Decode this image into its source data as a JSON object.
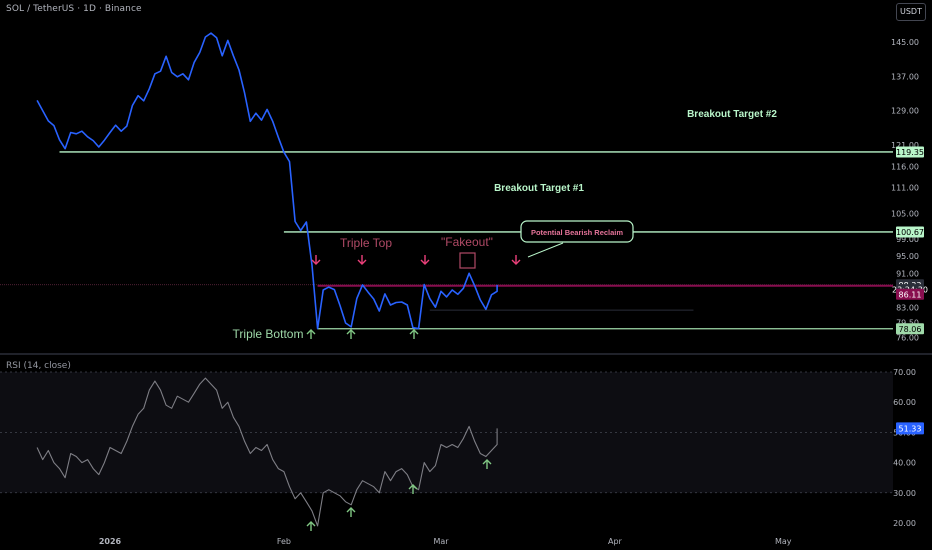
{
  "header": {
    "symbol": "SOL / TetherUS · 1D · Binance",
    "currency": "USDT"
  },
  "rsi_header": "RSI (14, close)",
  "price_axis": {
    "ticks": [
      "145.00",
      "137.00",
      "129.00",
      "121.00",
      "116.00",
      "111.00",
      "105.00",
      "99.00",
      "95.00",
      "91.00",
      "87.00",
      "83.00",
      "79.50",
      "76.00"
    ]
  },
  "price_badges": [
    {
      "label": "119.35",
      "value": 119.35,
      "color": "#b9f6ca",
      "text_color": "#000000"
    },
    {
      "label": "100.67",
      "value": 100.67,
      "color": "#b9f6ca",
      "text_color": "#000000"
    },
    {
      "label": "88.33",
      "value": 88.33,
      "color": "#2a2e39",
      "text_color": "#ffffff"
    },
    {
      "label": "23:24:30",
      "value": 87.2,
      "color": "#2a2e39",
      "text_color": "#ffffff"
    },
    {
      "label": "86.11",
      "value": 86.11,
      "color": "#880e4f",
      "text_color": "#ffffff"
    },
    {
      "label": "78.06",
      "value": 78.06,
      "color": "#9fd9a9",
      "text_color": "#000000"
    }
  ],
  "rsi_axis": {
    "ticks": [
      "70.00",
      "60.00",
      "50.00",
      "40.00",
      "30.00",
      "20.00"
    ],
    "badge": "51.33",
    "badge_value": 51.33
  },
  "time_axis": {
    "labels": [
      "2026",
      "Feb",
      "Mar",
      "Apr",
      "May"
    ]
  },
  "annotations": {
    "breakout2": "Breakout Target #2",
    "breakout1": "Breakout Target #1",
    "triple_top": "Triple Top",
    "fakeout": "\"Fakeout\"",
    "reclaim": "Potential Bearish Reclaim",
    "triple_bottom": "Triple Bottom"
  },
  "colors": {
    "price_line": "#2962ff",
    "rsi_line": "#7e7e85",
    "green_level": "#b9f6ca",
    "bottom_level": "#9fd9a9",
    "resistance": "#880e4f",
    "up_arrow": "#81c784",
    "down_arrow": "#ec407a",
    "label_red": "#b04a66"
  },
  "chart_data": [
    {
      "type": "line",
      "title": "SOL / TetherUS · 1D · Binance",
      "x": [
        "2025-12-19",
        "2025-12-20",
        "2025-12-21",
        "2025-12-22",
        "2025-12-23",
        "2025-12-24",
        "2025-12-25",
        "2025-12-26",
        "2025-12-27",
        "2025-12-28",
        "2025-12-29",
        "2025-12-30",
        "2025-12-31",
        "2026-01-01",
        "2026-01-02",
        "2026-01-03",
        "2026-01-04",
        "2026-01-05",
        "2026-01-06",
        "2026-01-07",
        "2026-01-08",
        "2026-01-09",
        "2026-01-10",
        "2026-01-11",
        "2026-01-12",
        "2026-01-13",
        "2026-01-14",
        "2026-01-15",
        "2026-01-16",
        "2026-01-17",
        "2026-01-18",
        "2026-01-19",
        "2026-01-20",
        "2026-01-21",
        "2026-01-22",
        "2026-01-23",
        "2026-01-24",
        "2026-01-25",
        "2026-01-26",
        "2026-01-27",
        "2026-01-28",
        "2026-01-29",
        "2026-01-30",
        "2026-01-31",
        "2026-02-01",
        "2026-02-02",
        "2026-02-03",
        "2026-02-04",
        "2026-02-05",
        "2026-02-06",
        "2026-02-07",
        "2026-02-08",
        "2026-02-09",
        "2026-02-10",
        "2026-02-11",
        "2026-02-12",
        "2026-02-13",
        "2026-02-14",
        "2026-02-15",
        "2026-02-16",
        "2026-02-17",
        "2026-02-18",
        "2026-02-19",
        "2026-02-20",
        "2026-02-21",
        "2026-02-22",
        "2026-02-23",
        "2026-02-24",
        "2026-02-25",
        "2026-02-26",
        "2026-02-27",
        "2026-02-28",
        "2026-03-01",
        "2026-03-02",
        "2026-03-03",
        "2026-03-04",
        "2026-03-05",
        "2026-03-06",
        "2026-03-07",
        "2026-03-08",
        "2026-03-09",
        "2026-03-10",
        "2026-03-11"
      ],
      "series": [
        {
          "name": "",
          "values": [
            131.4,
            129.0,
            126.6,
            125.5,
            122.2,
            120.1,
            123.9,
            123.6,
            124.2,
            122.9,
            122.0,
            120.5,
            122.1,
            123.9,
            125.6,
            124.2,
            125.4,
            130.2,
            132.5,
            131.3,
            134.1,
            137.6,
            138.2,
            141.7,
            137.9,
            136.9,
            137.6,
            136.2,
            140.3,
            142.6,
            146.2,
            147.1,
            146.0,
            141.8,
            145.4,
            141.8,
            138.5,
            133.1,
            126.5,
            128.4,
            126.8,
            129.3,
            126.5,
            122.8,
            119.3,
            117.1,
            103.1,
            101.0,
            103.0,
            92.9,
            78.1,
            87.1,
            87.8,
            87.2,
            83.5,
            79.4,
            78.5,
            85.1,
            88.3,
            86.6,
            85.0,
            82.2,
            86.2,
            83.6,
            84.2,
            84.3,
            83.6,
            78.3,
            78.1,
            88.4,
            85.1,
            83.1,
            86.8,
            85.5,
            87.1,
            86.1,
            87.5,
            91.0,
            88.1,
            84.8,
            82.6,
            86.0,
            86.8,
            88.0,
            87.4,
            88.3
          ]
        }
      ],
      "xlabel": "",
      "ylabel": "",
      "ylim": [
        74.5,
        149
      ],
      "levels": [
        {
          "value": 119.35,
          "label": "Breakout Target #2"
        },
        {
          "value": 100.67,
          "label": "Breakout Target #1"
        },
        {
          "value": 88.33,
          "label": ""
        },
        {
          "value": 78.06,
          "label": "Triple Bottom"
        }
      ],
      "grid": false
    },
    {
      "type": "line",
      "title": "RSI (14, close)",
      "x": [
        "2025-12-19",
        "2025-12-20",
        "2025-12-21",
        "2025-12-22",
        "2025-12-23",
        "2025-12-24",
        "2025-12-25",
        "2025-12-26",
        "2025-12-27",
        "2025-12-28",
        "2025-12-29",
        "2025-12-30",
        "2025-12-31",
        "2026-01-01",
        "2026-01-02",
        "2026-01-03",
        "2026-01-04",
        "2026-01-05",
        "2026-01-06",
        "2026-01-07",
        "2026-01-08",
        "2026-01-09",
        "2026-01-10",
        "2026-01-11",
        "2026-01-12",
        "2026-01-13",
        "2026-01-14",
        "2026-01-15",
        "2026-01-16",
        "2026-01-17",
        "2026-01-18",
        "2026-01-19",
        "2026-01-20",
        "2026-01-21",
        "2026-01-22",
        "2026-01-23",
        "2026-01-24",
        "2026-01-25",
        "2026-01-26",
        "2026-01-27",
        "2026-01-28",
        "2026-01-29",
        "2026-01-30",
        "2026-01-31",
        "2026-02-01",
        "2026-02-02",
        "2026-02-03",
        "2026-02-04",
        "2026-02-05",
        "2026-02-06",
        "2026-02-07",
        "2026-02-08",
        "2026-02-09",
        "2026-02-10",
        "2026-02-11",
        "2026-02-12",
        "2026-02-13",
        "2026-02-14",
        "2026-02-15",
        "2026-02-16",
        "2026-02-17",
        "2026-02-18",
        "2026-02-19",
        "2026-02-20",
        "2026-02-21",
        "2026-02-22",
        "2026-02-23",
        "2026-02-24",
        "2026-02-25",
        "2026-02-26",
        "2026-02-27",
        "2026-02-28",
        "2026-03-01",
        "2026-03-02",
        "2026-03-03",
        "2026-03-04",
        "2026-03-05",
        "2026-03-06",
        "2026-03-07",
        "2026-03-08",
        "2026-03-09",
        "2026-03-10",
        "2026-03-11"
      ],
      "series": [
        {
          "name": "",
          "values": [
            45,
            41,
            44,
            40,
            38,
            35,
            43,
            42,
            40,
            41,
            38,
            36,
            40,
            45,
            44,
            43,
            47,
            52,
            56,
            58,
            64,
            67,
            64,
            59,
            58,
            62,
            61,
            60,
            63,
            66,
            68,
            66,
            64,
            58,
            60,
            55,
            52,
            47,
            43,
            45,
            44,
            46,
            41,
            38,
            37,
            32,
            28,
            30,
            27,
            24,
            19,
            30,
            31,
            30,
            29,
            27,
            26,
            31,
            34,
            33,
            32,
            30,
            37,
            34,
            37,
            38,
            36,
            32,
            31,
            40,
            37,
            39,
            46,
            45,
            46,
            45,
            48,
            52,
            47,
            43,
            42,
            44,
            46,
            50,
            49,
            51.33
          ]
        }
      ],
      "ylim": [
        16,
        72
      ],
      "levels": [
        50,
        30
      ],
      "yticks": [
        70,
        60,
        50,
        40,
        30,
        20
      ]
    }
  ]
}
